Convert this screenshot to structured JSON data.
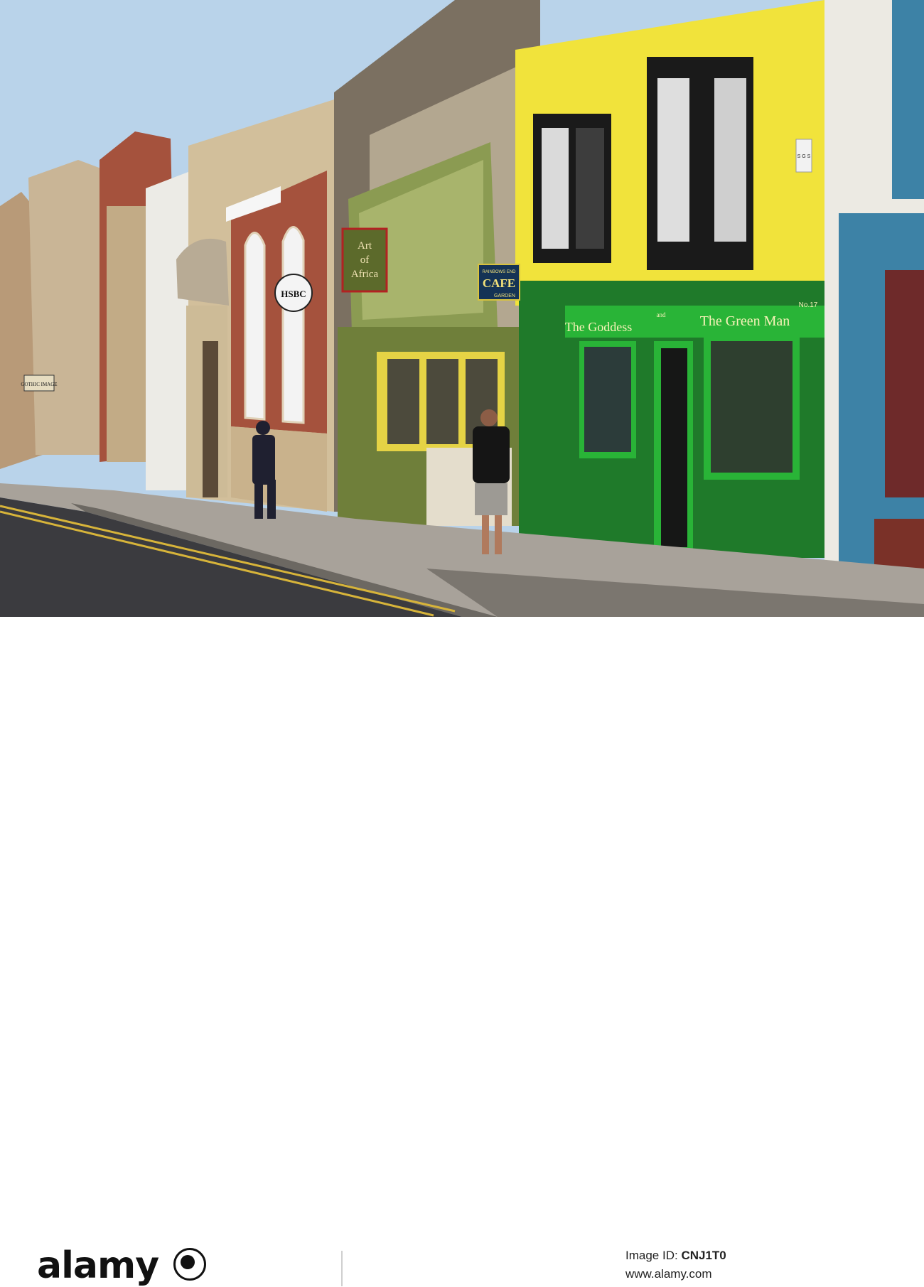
{
  "signs": {
    "bank_name": "HSBC",
    "shop_art": [
      "Art",
      "of",
      "Africa"
    ],
    "cafe_small": "RAINBOWS END",
    "cafe_large": "CAFE",
    "cafe_garden": "GARDEN",
    "shop_goddess": "The Goddess",
    "shop_and": "and",
    "shop_green_man": "The Green Man",
    "shop_number": "No.17",
    "shop_left": "GOTHIC IMAGE",
    "alarm_box": "S G S"
  },
  "banner": {
    "wordmark": "alamy",
    "image_id_label": "Image ID:",
    "image_id": "CNJ1T0",
    "site": "www.alamy.com"
  },
  "colors": {
    "sky": "#b9d3ea",
    "yellow_building": "#f1e33b",
    "green_shopfront": "#1f7a2a",
    "bright_green": "#29b437",
    "brick": "#a5523d",
    "stone": "#c8b08a",
    "blue_building": "#3d82a6",
    "road": "#3b3b3f",
    "pavement": "#a8a29a"
  }
}
